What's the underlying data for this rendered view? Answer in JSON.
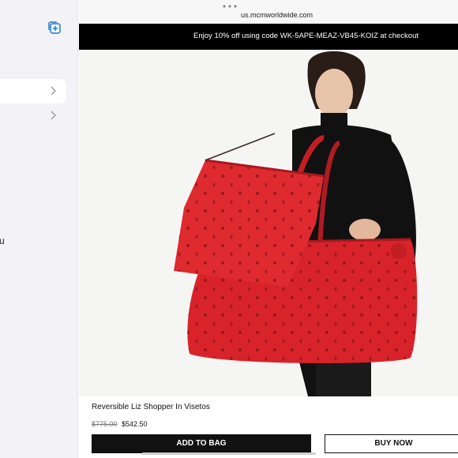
{
  "sidebar": {
    "truncated_label": "u"
  },
  "browser": {
    "url": "us.mcmworldwide.com"
  },
  "promo": {
    "text": "Enjoy 10% off  using code  WK-5APE-MEAZ-VB45-KOIZ  at checkout"
  },
  "product": {
    "title": "Reversible Liz Shopper In Visetos",
    "original_price": "$775.00",
    "sale_price": "$542.50",
    "bag_color": "#d8232a"
  },
  "actions": {
    "add_to_bag": "ADD TO BAG",
    "buy_now": "BUY NOW"
  },
  "icons": [
    "new-tab-icon",
    "chevron-right-icon",
    "more-dots-icon"
  ]
}
